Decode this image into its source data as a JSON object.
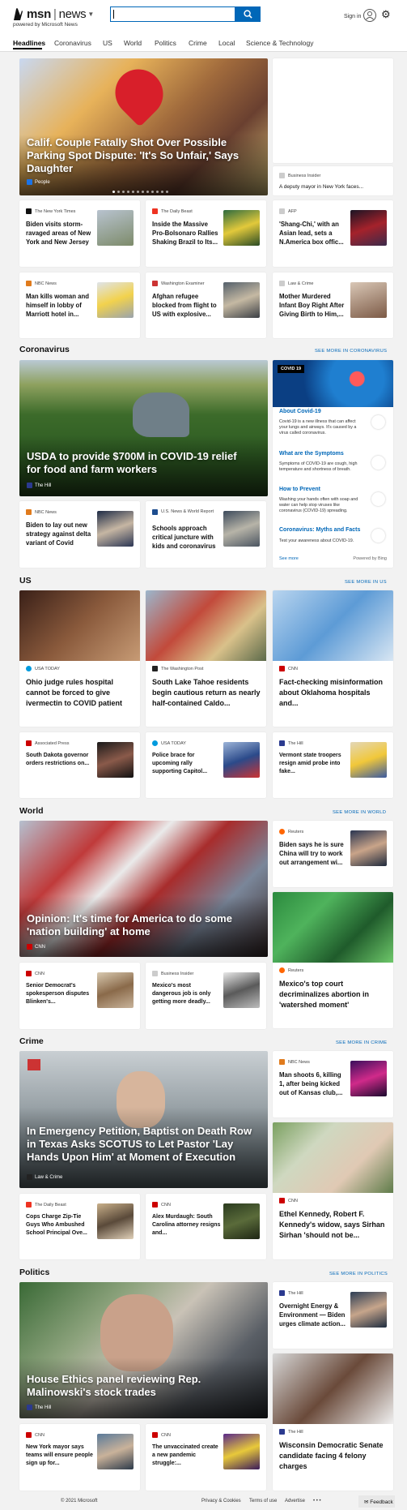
{
  "header": {
    "brand": "msn",
    "section": "news",
    "powered_by": "powered by Microsoft News",
    "search_placeholder": "",
    "sign_in": "Sign in"
  },
  "nav": [
    "Headlines",
    "Coronavirus",
    "US",
    "World",
    "Politics",
    "Crime",
    "Local",
    "Science & Technology"
  ],
  "top": {
    "hero": {
      "title": "Calif. Couple Fatally Shot Over Possible Parking Spot Dispute: 'It's So Unfair,' Says Daughter",
      "source": "People"
    },
    "side": {
      "source": "Business Insider",
      "title": "A deputy mayor in New York faces..."
    },
    "cards": [
      {
        "source": "The New York Times",
        "title": "Biden visits storm-ravaged areas of New York and New Jersey"
      },
      {
        "source": "The Daily Beast",
        "title": "Inside the Massive Pro-Bolsonaro Rallies Shaking Brazil to Its..."
      },
      {
        "source": "AFP",
        "title": "'Shang-Chi,' with an Asian lead, sets a N.America box offic..."
      },
      {
        "source": "NBC News",
        "title": "Man kills woman and himself in lobby of Marriott hotel in..."
      },
      {
        "source": "Washington Examiner",
        "title": "Afghan refugee blocked from flight to US with explosive..."
      },
      {
        "source": "Law & Crime",
        "title": "Mother Murdered Infant Boy Right After Giving Birth to Him,..."
      }
    ]
  },
  "coronavirus": {
    "heading": "Coronavirus",
    "see_more": "SEE MORE IN CORONAVIRUS",
    "hero": {
      "title": "USDA to provide $700M in COVID-19 relief for food and farm workers",
      "source": "The Hill"
    },
    "cards": [
      {
        "source": "NBC News",
        "title": "Biden to lay out new strategy against delta variant of Covid"
      },
      {
        "source": "U.S. News & World Report",
        "title": "Schools approach critical juncture with kids and coronavirus"
      }
    ],
    "panel": {
      "badge": "COVID 19",
      "items": [
        {
          "title": "About Covid-19",
          "desc": "Covid-19 is a new illness that can affect your lungs and airways. It's caused by a virus called coronavirus."
        },
        {
          "title": "What are the Symptoms",
          "desc": "Symptoms of COVID-19 are cough, high temperature and shortness of breath."
        },
        {
          "title": "How to Prevent",
          "desc": "Washing your hands often with soap and water can help stop viruses like coronavirus (COVID-19) spreading."
        },
        {
          "title": "Coronavirus: Myths and Facts",
          "desc": "Test your awareness about COVID-19."
        }
      ],
      "see_more": "See more",
      "powered": "Powered by Bing"
    }
  },
  "us": {
    "heading": "US",
    "see_more": "SEE MORE IN US",
    "big": [
      {
        "source": "USA TODAY",
        "title": "Ohio judge rules hospital cannot be forced to give ivermectin to COVID patient"
      },
      {
        "source": "The Washington Post",
        "title": "South Lake Tahoe residents begin cautious return as nearly half-contained Caldo..."
      },
      {
        "source": "CNN",
        "title": "Fact-checking misinformation about Oklahoma hospitals and..."
      }
    ],
    "small": [
      {
        "source": "Associated Press",
        "title": "South Dakota governor orders restrictions on..."
      },
      {
        "source": "USA TODAY",
        "title": "Police brace for upcoming rally supporting Capitol..."
      },
      {
        "source": "The Hill",
        "title": "Vermont state troopers resign amid probe into fake..."
      }
    ]
  },
  "world": {
    "heading": "World",
    "see_more": "SEE MORE IN WORLD",
    "hero": {
      "title": "Opinion: It's time for America to do some 'nation building' at home",
      "source": "CNN"
    },
    "side": {
      "source": "Reuters",
      "title": "Biden says he is sure China will try to work out arrangement wi..."
    },
    "side_big": {
      "source": "Reuters",
      "title": "Mexico's top court decriminalizes abortion in 'watershed moment'"
    },
    "cards": [
      {
        "source": "CNN",
        "title": "Senior Democrat's spokesperson disputes Blinken's..."
      },
      {
        "source": "Business Insider",
        "title": "Mexico's most dangerous job is only getting more deadly..."
      }
    ]
  },
  "crime": {
    "heading": "Crime",
    "see_more": "SEE MORE IN CRIME",
    "hero": {
      "title": "In Emergency Petition, Baptist on Death Row in Texas Asks SCOTUS to Let Pastor 'Lay Hands Upon Him' at Moment of Execution",
      "source": "Law & Crime"
    },
    "side": {
      "source": "NBC News",
      "title": "Man shoots 6, killing 1, after being kicked out of Kansas club,..."
    },
    "side_big": {
      "source": "CNN",
      "title": "Ethel Kennedy, Robert F. Kennedy's widow, says Sirhan Sirhan 'should not be..."
    },
    "cards": [
      {
        "source": "The Daily Beast",
        "title": "Cops Charge Zip-Tie Guys Who Ambushed School Principal Ove..."
      },
      {
        "source": "CNN",
        "title": "Alex Murdaugh: South Carolina attorney resigns and..."
      }
    ]
  },
  "politics": {
    "heading": "Politics",
    "see_more": "SEE MORE IN POLITICS",
    "hero": {
      "title": "House Ethics panel reviewing Rep. Malinowski's stock trades",
      "source": "The Hill"
    },
    "side": {
      "source": "The Hill",
      "title": "Overnight Energy & Environment — Biden urges climate action..."
    },
    "side_big": {
      "source": "The Hill",
      "title": "Wisconsin Democratic Senate candidate facing 4 felony charges"
    },
    "cards": [
      {
        "source": "CNN",
        "title": "New York mayor says teams will ensure people sign up for..."
      },
      {
        "source": "CNN",
        "title": "The unvaccinated create a new pandemic struggle:..."
      }
    ]
  },
  "footer": {
    "copyright": "© 2021 Microsoft",
    "links": [
      "Privacy & Cookies",
      "Terms of use",
      "Advertise"
    ],
    "more": "• • •",
    "feedback": "Feedback"
  },
  "colors": {
    "accent": "#0067b8"
  }
}
